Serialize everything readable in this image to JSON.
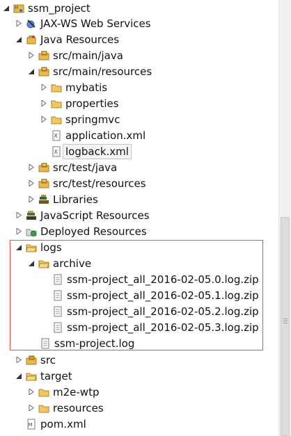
{
  "tree": {
    "project": "ssm_project",
    "jaxws": "JAX-WS Web Services",
    "java_resources": "Java Resources",
    "src_main_java": "src/main/java",
    "src_main_resources": "src/main/resources",
    "mybatis": "mybatis",
    "properties": "properties",
    "springmvc": "springmvc",
    "application_xml": "application.xml",
    "logback_xml": "logback.xml",
    "src_test_java": "src/test/java",
    "src_test_resources": "src/test/resources",
    "libraries": "Libraries",
    "javascript_resources": "JavaScript Resources",
    "deployed_resources": "Deployed Resources",
    "logs": "logs",
    "archive": "archive",
    "zips": [
      "ssm-project_all_2016-02-05.0.log.zip",
      "ssm-project_all_2016-02-05.1.log.zip",
      "ssm-project_all_2016-02-05.2.log.zip",
      "ssm-project_all_2016-02-05.3.log.zip"
    ],
    "log_file": "ssm-project.log",
    "src": "src",
    "target": "target",
    "m2e_wtp": "m2e-wtp",
    "resources": "resources",
    "pom_xml": "pom.xml"
  },
  "colors": {
    "highlight_border": "#e05050",
    "folder": "#e8b84a",
    "selection_border": "#c7c7c7"
  }
}
